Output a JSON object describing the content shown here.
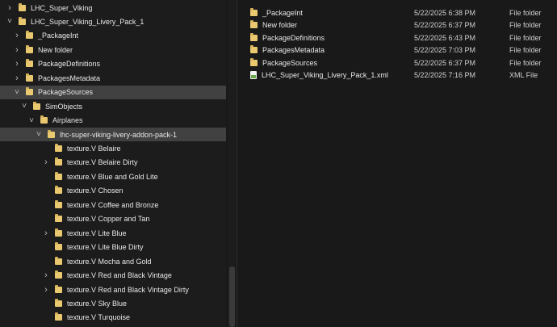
{
  "nav_tree": [
    {
      "label": "LHC_Super_Viking",
      "chevron": "right",
      "icon": "folder-icon"
    },
    {
      "label": "LHC_Super_Viking_Livery_Pack_1",
      "chevron": "down",
      "icon": "folder-icon"
    },
    {
      "label": "_PackageInt",
      "chevron": "right",
      "icon": "folder-icon"
    },
    {
      "label": "New folder",
      "chevron": "right",
      "icon": "folder-icon"
    },
    {
      "label": "PackageDefinitions",
      "chevron": "right",
      "icon": "folder-icon"
    },
    {
      "label": "PackagesMetadata",
      "chevron": "right",
      "icon": "folder-icon"
    },
    {
      "label": "PackageSources",
      "chevron": "down",
      "icon": "folder-icon",
      "selected": true
    },
    {
      "label": "SimObjects",
      "chevron": "down",
      "icon": "folder-icon"
    },
    {
      "label": "Airplanes",
      "chevron": "down",
      "icon": "folder-icon"
    },
    {
      "label": "lhc-super-viking-livery-addon-pack-1",
      "chevron": "down",
      "icon": "folder-icon",
      "selected": true
    },
    {
      "label": "texture.V Belaire",
      "chevron": "none",
      "icon": "folder-icon"
    },
    {
      "label": "texture.V Belaire Dirty",
      "chevron": "right",
      "icon": "folder-icon"
    },
    {
      "label": "texture.V Blue and Gold Lite",
      "chevron": "none",
      "icon": "folder-icon"
    },
    {
      "label": "texture.V Chosen",
      "chevron": "none",
      "icon": "folder-icon"
    },
    {
      "label": "texture.V Coffee and Bronze",
      "chevron": "none",
      "icon": "folder-icon"
    },
    {
      "label": "texture.V Copper and Tan",
      "chevron": "none",
      "icon": "folder-icon"
    },
    {
      "label": "texture.V Lite Blue",
      "chevron": "right",
      "icon": "folder-icon"
    },
    {
      "label": "texture.V Lite Blue Dirty",
      "chevron": "none",
      "icon": "folder-icon"
    },
    {
      "label": "texture.V Mocha and Gold",
      "chevron": "none",
      "icon": "folder-icon"
    },
    {
      "label": "texture.V Red and Black Vintage",
      "chevron": "right",
      "icon": "folder-icon"
    },
    {
      "label": "texture.V Red and Black Vintage Dirty",
      "chevron": "right",
      "icon": "folder-icon"
    },
    {
      "label": "texture.V Sky Blue",
      "chevron": "none",
      "icon": "folder-icon"
    },
    {
      "label": "texture.V Turquoise",
      "chevron": "none",
      "icon": "folder-icon"
    }
  ],
  "files": [
    {
      "name": "_PackageInt",
      "date": "5/22/2025 6:38 PM",
      "type": "File folder",
      "icon": "folder-icon"
    },
    {
      "name": "New folder",
      "date": "5/22/2025 6:37 PM",
      "type": "File folder",
      "icon": "folder-icon"
    },
    {
      "name": "PackageDefinitions",
      "date": "5/22/2025 6:43 PM",
      "type": "File folder",
      "icon": "folder-icon"
    },
    {
      "name": "PackagesMetadata",
      "date": "5/22/2025 7:03 PM",
      "type": "File folder",
      "icon": "folder-icon"
    },
    {
      "name": "PackageSources",
      "date": "5/22/2025 6:37 PM",
      "type": "File folder",
      "icon": "folder-icon"
    },
    {
      "name": "LHC_Super_Viking_Livery_Pack_1.xml",
      "date": "5/22/2025 7:16 PM",
      "type": "XML File",
      "icon": "xml-file-icon"
    }
  ],
  "colors": {
    "background": "#191919",
    "selected_row": "#414141",
    "folder": "#e9c870"
  }
}
